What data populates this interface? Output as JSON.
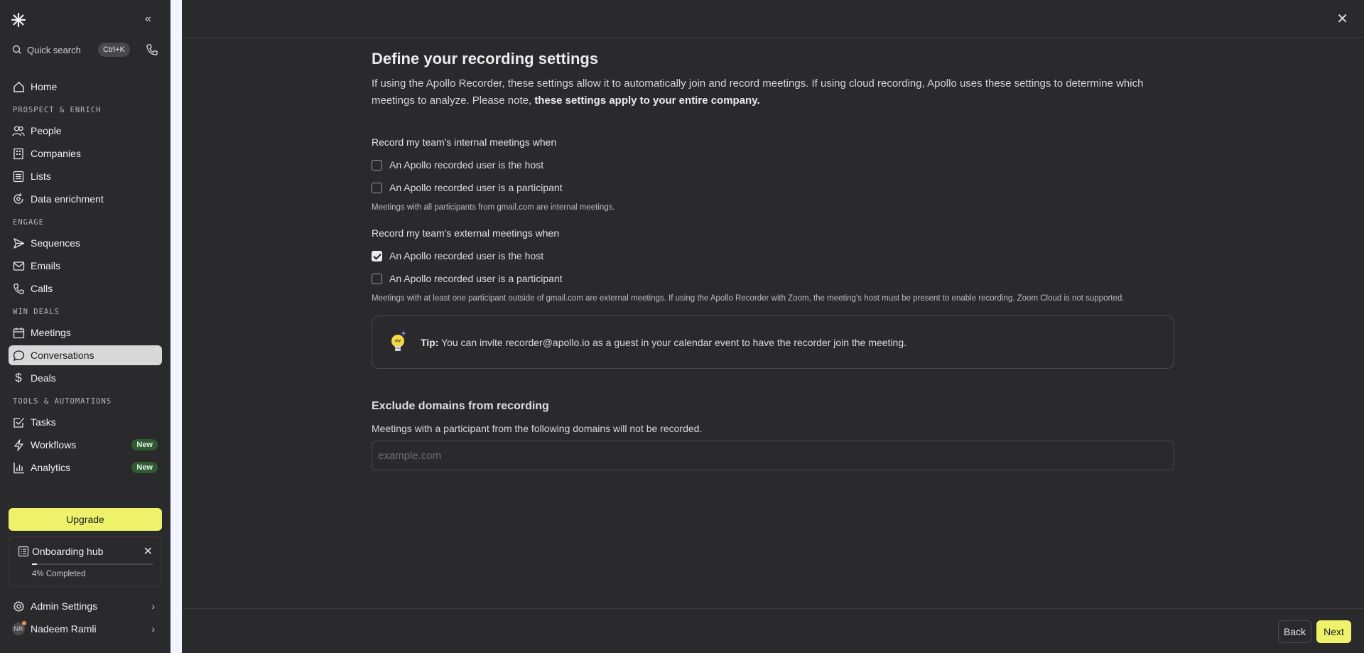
{
  "sidebar": {
    "search_label": "Quick search",
    "shortcut": "Ctrl+K",
    "nav": {
      "home": "Home",
      "section_prospect": "PROSPECT & ENRICH",
      "people": "People",
      "companies": "Companies",
      "lists": "Lists",
      "data_enrichment": "Data enrichment",
      "section_engage": "ENGAGE",
      "sequences": "Sequences",
      "emails": "Emails",
      "calls": "Calls",
      "section_win": "WIN DEALS",
      "meetings": "Meetings",
      "conversations": "Conversations",
      "deals": "Deals",
      "section_tools": "TOOLS & AUTOMATIONS",
      "tasks": "Tasks",
      "workflows": "Workflows",
      "analytics": "Analytics",
      "new_badge": "New"
    },
    "upgrade_label": "Upgrade",
    "onboarding": {
      "title": "Onboarding hub",
      "progress_label": "4% Completed",
      "progress": 0.04
    },
    "admin_settings": "Admin Settings",
    "user_name": "Nadeem Ramli",
    "user_initials": "NR"
  },
  "main": {
    "title": "Define your recording settings",
    "description": "If using the Apollo Recorder, these settings allow it to automatically join and record meetings. If using cloud recording, Apollo uses these settings to determine which meetings to analyze. Please note, ",
    "description_bold": "these settings apply to your entire company.",
    "internal": {
      "title": "Record my team's internal meetings when",
      "host": "An Apollo recorded user is the host",
      "participant": "An Apollo recorded user is a participant",
      "note": "Meetings with all participants from gmail.com are internal meetings."
    },
    "external": {
      "title": "Record my team's external meetings when",
      "host": "An Apollo recorded user is the host",
      "participant": "An Apollo recorded user is a participant",
      "note": "Meetings with at least one participant outside of gmail.com are external meetings. If using the Apollo Recorder with Zoom, the meeting's host must be present to enable recording. Zoom Cloud is not supported."
    },
    "tip": {
      "label": "Tip:",
      "text": " You can invite recorder@apollo.io as a guest in your calendar event to have the recorder join the meeting."
    },
    "exclude": {
      "title": "Exclude domains from recording",
      "subtitle": "Meetings with a participant from the following domains will not be recorded.",
      "placeholder": "example.com",
      "value": ""
    },
    "back_label": "Back",
    "next_label": "Next"
  },
  "colors": {
    "accent": "#eef26a",
    "background": "#2a2a2c",
    "badge": "#2f5a32"
  }
}
